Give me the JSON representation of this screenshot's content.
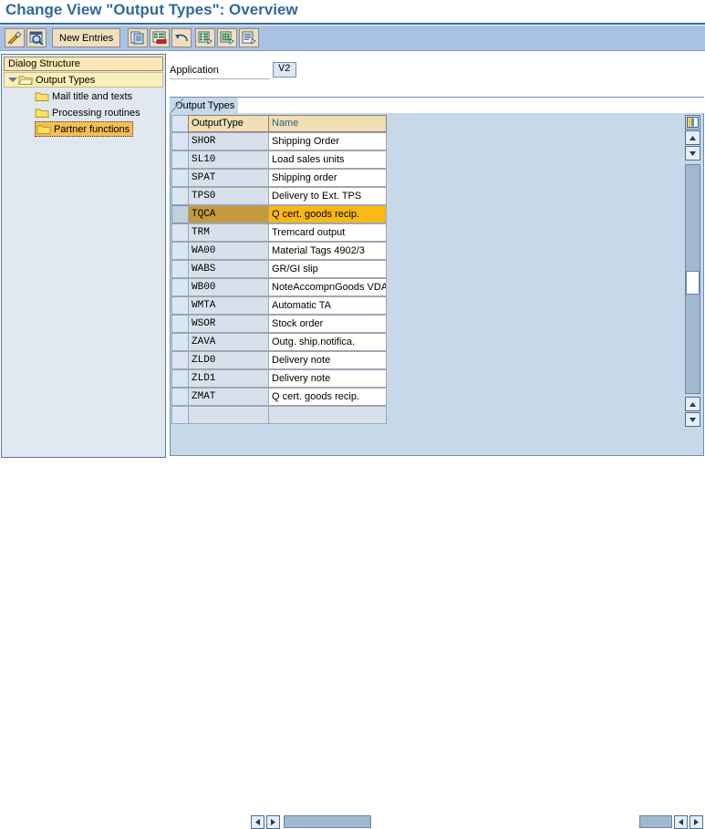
{
  "window": {
    "title": "Change View \"Output Types\": Overview"
  },
  "toolbar": {
    "buttons": [
      {
        "name": "display-change-button",
        "icon": "pencil-wrench-icon",
        "label": ""
      },
      {
        "name": "display-details-button",
        "icon": "magnifier-icon",
        "label": ""
      },
      {
        "name": "new-entries-button",
        "icon": "",
        "label": "New Entries"
      },
      {
        "name": "copy-as-button",
        "icon": "copy-document-icon",
        "label": ""
      },
      {
        "name": "delete-button",
        "icon": "delete-row-icon",
        "label": ""
      },
      {
        "name": "undo-button",
        "icon": "undo-arrow-icon",
        "label": ""
      },
      {
        "name": "select-all-button",
        "icon": "select-all-icon",
        "label": ""
      },
      {
        "name": "deselect-all-button",
        "icon": "deselect-all-icon",
        "label": ""
      },
      {
        "name": "details-button",
        "icon": "details-list-icon",
        "label": ""
      }
    ]
  },
  "sidebar": {
    "header": "Dialog Structure",
    "items": [
      {
        "label": "Output Types",
        "level": 0,
        "expanded": true,
        "selected": false
      },
      {
        "label": "Mail title and texts",
        "level": 1,
        "expanded": false,
        "selected": false
      },
      {
        "label": "Processing routines",
        "level": 1,
        "expanded": false,
        "selected": false
      },
      {
        "label": "Partner functions",
        "level": 1,
        "expanded": false,
        "selected": true
      }
    ]
  },
  "form": {
    "application_label": "Application",
    "application_value": "V2"
  },
  "tabs": [
    {
      "label": "Output Types",
      "active": true
    }
  ],
  "table": {
    "columns": [
      "OutputType",
      "Name"
    ],
    "rows": [
      {
        "code": "SHOR",
        "name": "Shipping Order",
        "selected": false
      },
      {
        "code": "SL10",
        "name": "Load sales units",
        "selected": false
      },
      {
        "code": "SPAT",
        "name": "Shipping order",
        "selected": false
      },
      {
        "code": "TPS0",
        "name": "Delivery to Ext. TPS",
        "selected": false
      },
      {
        "code": "TQCA",
        "name": "Q cert. goods recip.",
        "selected": true
      },
      {
        "code": "TRM",
        "name": "Tremcard output",
        "selected": false
      },
      {
        "code": "WA00",
        "name": "Material Tags 4902/3",
        "selected": false
      },
      {
        "code": "WABS",
        "name": "GR/GI slip",
        "selected": false
      },
      {
        "code": "WB00",
        "name": "NoteAccompnGoods VDA",
        "selected": false
      },
      {
        "code": "WMTA",
        "name": "Automatic TA",
        "selected": false
      },
      {
        "code": "WSOR",
        "name": "Stock order",
        "selected": false
      },
      {
        "code": "ZAVA",
        "name": "Outg. ship.notifica.",
        "selected": false
      },
      {
        "code": "ZLD0",
        "name": "Delivery note",
        "selected": false
      },
      {
        "code": "ZLD1",
        "name": "Delivery note",
        "selected": false
      },
      {
        "code": "ZMAT",
        "name": "Q cert. goods recip.",
        "selected": false
      },
      {
        "code": "",
        "name": "",
        "selected": false,
        "blank": true
      }
    ]
  },
  "scrollbars": {
    "config_icon": "table-settings-icon",
    "up_arrow": "scroll-up-icon",
    "down_arrow": "scroll-down-icon",
    "left_arrow": "scroll-left-icon",
    "right_arrow": "scroll-right-icon"
  },
  "colors": {
    "title": "#2E6A9E",
    "toolbar_bg": "#A9C2E4",
    "button_bg": "#EFDFBD",
    "panel_bg": "#E1E7EF",
    "content_bg": "#C7D8E8",
    "header_cell": "#F0DEB4",
    "selected_row": "#FBB813",
    "selected_code": "#C59A3C",
    "tree_selected": "#F5BE53"
  }
}
